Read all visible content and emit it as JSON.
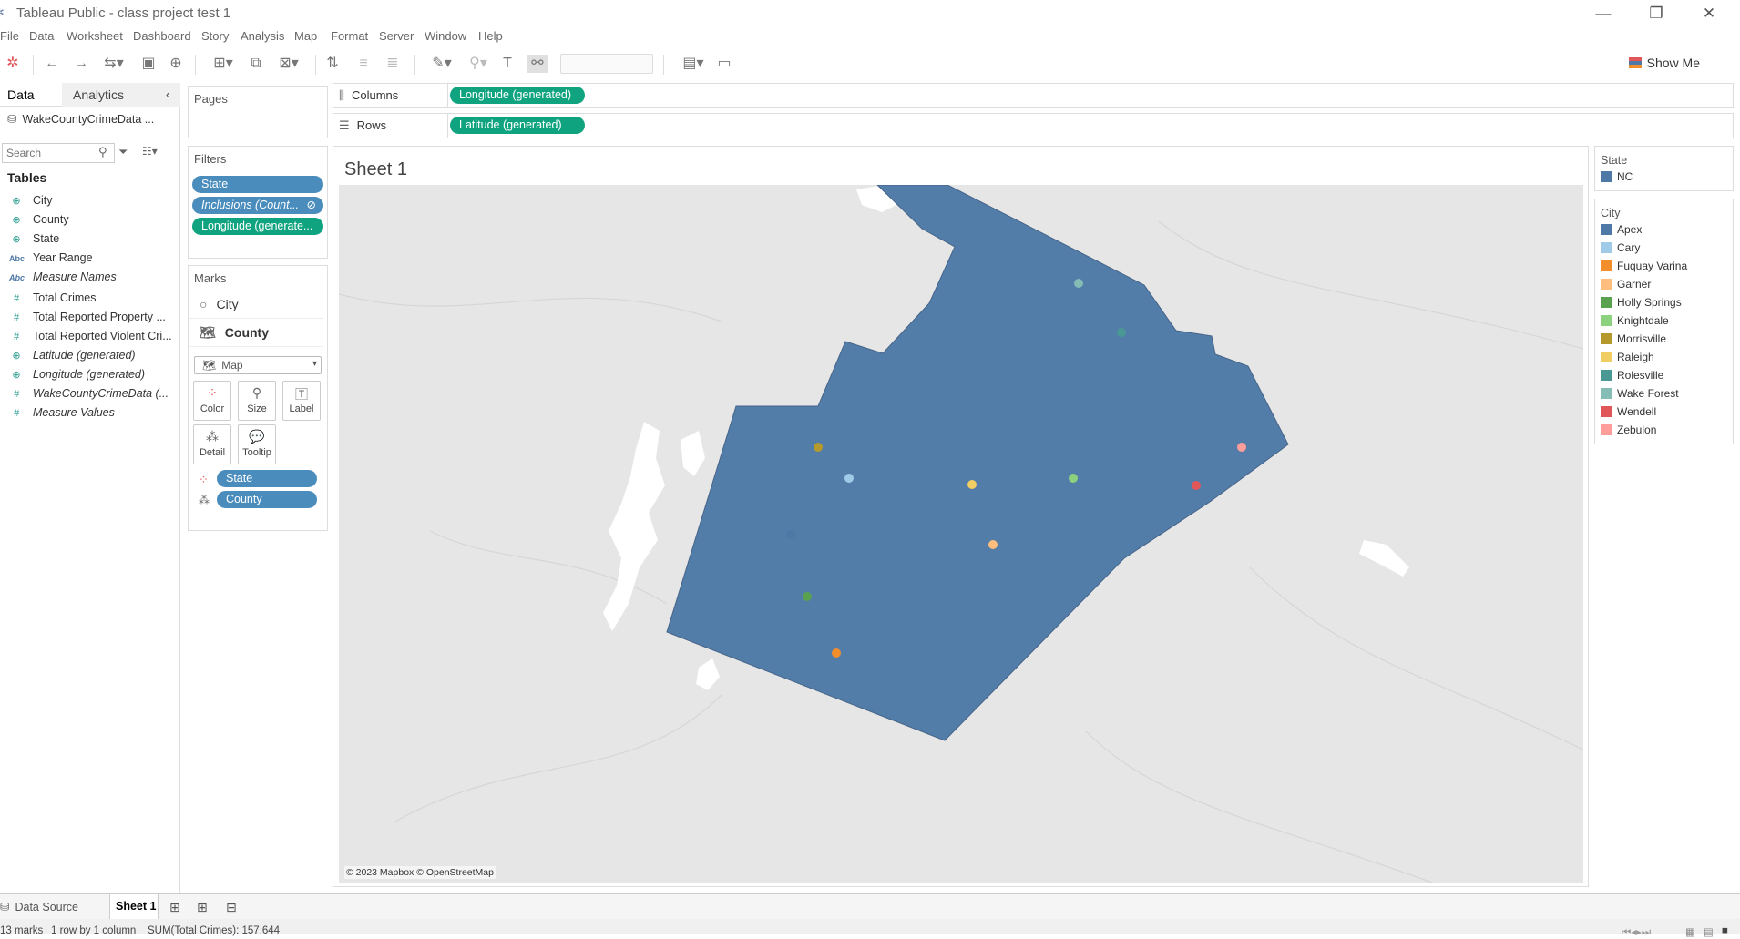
{
  "window": {
    "title": "Tableau Public - class project test 1"
  },
  "menu": [
    "File",
    "Data",
    "Worksheet",
    "Dashboard",
    "Story",
    "Analysis",
    "Map",
    "Format",
    "Server",
    "Window",
    "Help"
  ],
  "toolbar": {
    "show_me_label": "Show Me"
  },
  "left_pane": {
    "tab_data": "Data",
    "tab_analytics": "Analytics",
    "data_source": "WakeCountyCrimeData ...",
    "search_placeholder": "Search",
    "tables_heading": "Tables",
    "fields": [
      {
        "type": "geo",
        "icon": "globe-icon",
        "label": "City",
        "italic": false
      },
      {
        "type": "geo",
        "icon": "globe-icon",
        "label": "County",
        "italic": false
      },
      {
        "type": "geo",
        "icon": "globe-icon",
        "label": "State",
        "italic": false
      },
      {
        "type": "abc",
        "icon": "abc-icon",
        "label": "Year Range",
        "italic": false
      },
      {
        "type": "abc",
        "icon": "abc-icon",
        "label": "Measure Names",
        "italic": true
      },
      {
        "type": "num",
        "icon": "hash-icon",
        "label": "Total Crimes",
        "italic": false
      },
      {
        "type": "num",
        "icon": "hash-icon",
        "label": "Total Reported Property ...",
        "italic": false
      },
      {
        "type": "num",
        "icon": "hash-icon",
        "label": "Total Reported Violent Cri...",
        "italic": false
      },
      {
        "type": "geo",
        "icon": "globe-icon",
        "label": "Latitude (generated)",
        "italic": true
      },
      {
        "type": "geo",
        "icon": "globe-icon",
        "label": "Longitude (generated)",
        "italic": true
      },
      {
        "type": "num",
        "icon": "hash-icon",
        "label": "WakeCountyCrimeData (...",
        "italic": true
      },
      {
        "type": "num",
        "icon": "hash-icon",
        "label": "Measure Values",
        "italic": true
      }
    ]
  },
  "pages_card": {
    "title": "Pages"
  },
  "filters_card": {
    "title": "Filters",
    "pills": [
      {
        "label": "State",
        "color": "blue"
      },
      {
        "label": "Inclusions (Count...",
        "color": "blue"
      },
      {
        "label": "Longitude (generate...",
        "color": "green"
      }
    ]
  },
  "marks_card": {
    "title": "Marks",
    "layers": [
      "City",
      "County"
    ],
    "mark_type": "Map",
    "buttons": [
      "Color",
      "Size",
      "Label",
      "Detail",
      "Tooltip"
    ],
    "pills": [
      {
        "label": "State",
        "icon": "color-dots-icon"
      },
      {
        "label": "County",
        "icon": "detail-dots-icon"
      }
    ]
  },
  "shelves": {
    "columns_label": "Columns",
    "columns_pill": "Longitude (generated)",
    "rows_label": "Rows",
    "rows_pill": "Latitude (generated)"
  },
  "sheet": {
    "title": "Sheet 1",
    "attribution": "© 2023 Mapbox © OpenStreetMap",
    "county_fill": "#4e79a7",
    "city_points": [
      {
        "city": "Apex",
        "color": "#4e79a7"
      },
      {
        "city": "Cary",
        "color": "#a0cbe8"
      },
      {
        "city": "Fuquay Varina",
        "color": "#f28e2b"
      },
      {
        "city": "Garner",
        "color": "#ffbe7d"
      },
      {
        "city": "Holly Springs",
        "color": "#59a14f"
      },
      {
        "city": "Knightdale",
        "color": "#8cd17d"
      },
      {
        "city": "Morrisville",
        "color": "#b6992d"
      },
      {
        "city": "Raleigh",
        "color": "#f1ce63"
      },
      {
        "city": "Rolesville",
        "color": "#499894"
      },
      {
        "city": "Wake Forest",
        "color": "#86bcb6"
      },
      {
        "city": "Wendell",
        "color": "#e15759"
      },
      {
        "city": "Zebulon",
        "color": "#ff9d9a"
      }
    ]
  },
  "legends": {
    "state_title": "State",
    "state_items": [
      {
        "label": "NC",
        "color": "#4e79a7"
      }
    ],
    "city_title": "City",
    "city_items": [
      {
        "label": "Apex",
        "color": "#4e79a7"
      },
      {
        "label": "Cary",
        "color": "#a0cbe8"
      },
      {
        "label": "Fuquay Varina",
        "color": "#f28e2b"
      },
      {
        "label": "Garner",
        "color": "#ffbe7d"
      },
      {
        "label": "Holly Springs",
        "color": "#59a14f"
      },
      {
        "label": "Knightdale",
        "color": "#8cd17d"
      },
      {
        "label": "Morrisville",
        "color": "#b6992d"
      },
      {
        "label": "Raleigh",
        "color": "#f1ce63"
      },
      {
        "label": "Rolesville",
        "color": "#499894"
      },
      {
        "label": "Wake Forest",
        "color": "#86bcb6"
      },
      {
        "label": "Wendell",
        "color": "#e15759"
      },
      {
        "label": "Zebulon",
        "color": "#ff9d9a"
      }
    ]
  },
  "bottom_tabs": {
    "data_source": "Data Source",
    "sheet": "Sheet 1"
  },
  "status": {
    "marks": "13 marks",
    "rows_cols": "1 row by 1 column",
    "sum": "SUM(Total Crimes): 157,644"
  }
}
